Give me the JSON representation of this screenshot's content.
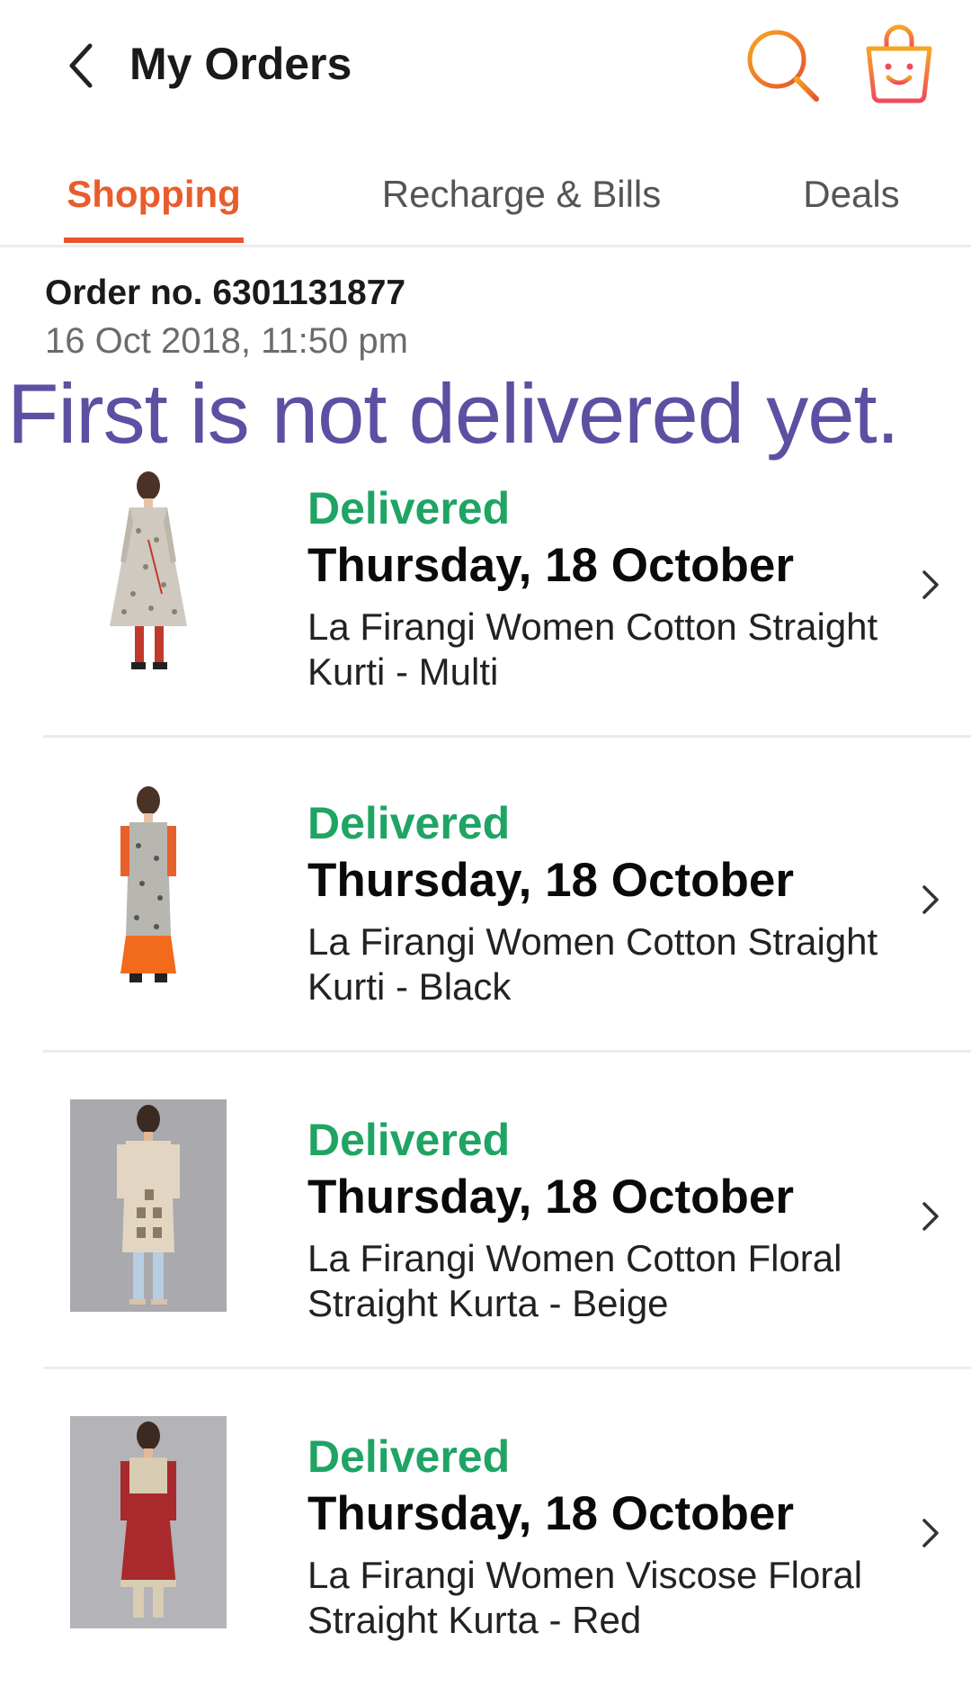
{
  "header": {
    "title": "My Orders",
    "back_icon": "chevron-left-icon",
    "search_icon": "search-icon",
    "bag_icon": "shopping-bag-icon"
  },
  "tabs": [
    {
      "label": "Shopping",
      "active": true
    },
    {
      "label": "Recharge & Bills",
      "active": false
    },
    {
      "label": "Deals",
      "active": false
    }
  ],
  "order": {
    "number_label": "Order no. 6301131877",
    "datetime": "16 Oct 2018, 11:50 pm"
  },
  "overlay_note": "First is not delivered yet.",
  "items": [
    {
      "status": "Delivered",
      "date": "Thursday, 18 October",
      "name": "La Firangi Women Cotton Straight Kurti - Multi"
    },
    {
      "status": "Delivered",
      "date": "Thursday, 18 October",
      "name": "La Firangi Women Cotton Straight Kurti - Black"
    },
    {
      "status": "Delivered",
      "date": "Thursday, 18 October",
      "name": "La Firangi Women Cotton Floral Straight Kurta - Beige"
    },
    {
      "status": "Delivered",
      "date": "Thursday, 18 October",
      "name": "La Firangi Women Viscose Floral Straight Kurta - Red"
    }
  ],
  "colors": {
    "accent": "#e85d2c",
    "delivered": "#1fa463",
    "overlay_text": "#5b50a2"
  }
}
